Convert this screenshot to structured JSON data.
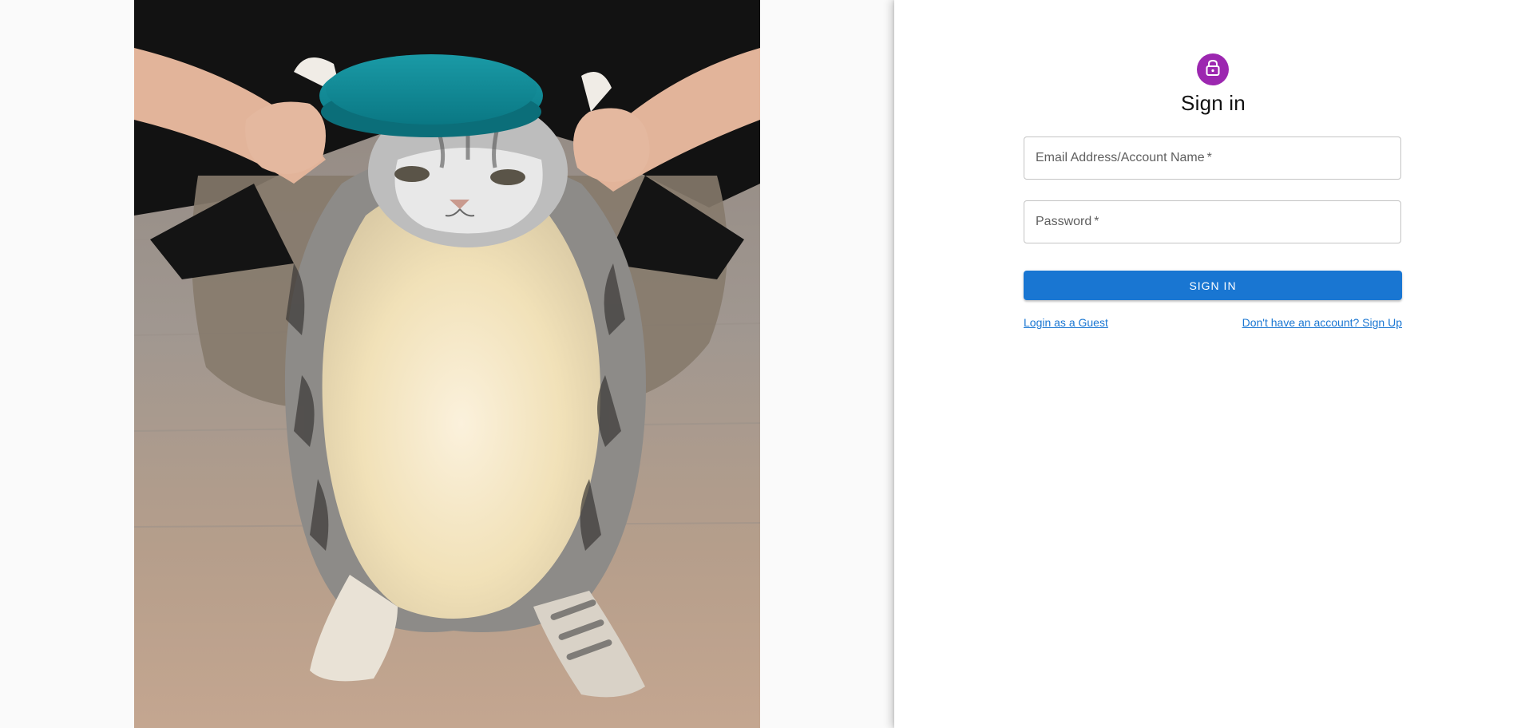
{
  "hero": {
    "image_alt": "cat wearing a teal beret"
  },
  "auth": {
    "icon": "lock-icon",
    "title": "Sign in",
    "email": {
      "label": "Email Address/Account Name",
      "required_mark": "*",
      "value": ""
    },
    "password": {
      "label": "Password",
      "required_mark": "*",
      "value": ""
    },
    "submit_label": "Sign In",
    "guest_link": "Login as a Guest",
    "signup_link": "Don't have an account? Sign Up"
  },
  "colors": {
    "primary": "#1976d2",
    "avatar": "#9c27b0",
    "background": "#fafafa",
    "panel": "#ffffff"
  }
}
